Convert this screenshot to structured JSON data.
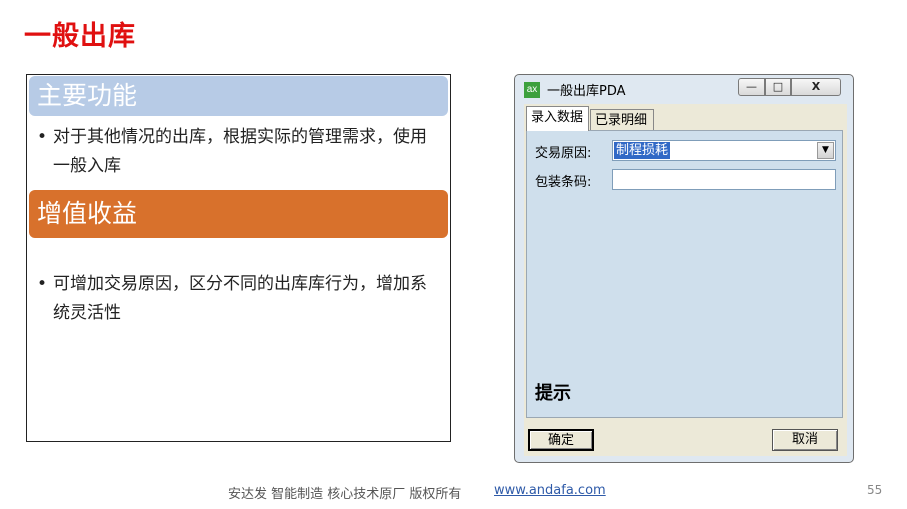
{
  "slide": {
    "title": "一般出库",
    "section1": {
      "header": "主要功能",
      "bullet": "对于其他情况的出库，根据实际的管理需求，使用一般入库"
    },
    "section2": {
      "header": "增值收益",
      "bullet": "可增加交易原因，区分不同的出库库行为，增加系统灵活性"
    }
  },
  "window": {
    "icon_text": "ax",
    "title": "一般出库PDA",
    "controls": {
      "minimize": "—",
      "maximize": "□",
      "close": "X"
    },
    "tabs": [
      {
        "label": "录入数据",
        "active": true
      },
      {
        "label": "已录明细",
        "active": false
      }
    ],
    "form": {
      "reason_label": "交易原因:",
      "reason_value": "制程损耗",
      "barcode_label": "包装条码:",
      "barcode_value": ""
    },
    "hint_label": "提示",
    "buttons": {
      "ok": "确定",
      "cancel": "取消"
    }
  },
  "footer": {
    "text": "安达发   智能制造 核心技术原厂    版权所有",
    "link": "www.andafa.com",
    "page_number": "55"
  },
  "colors": {
    "title_red": "#e01010",
    "header_blue": "#b7cbe6",
    "header_orange": "#d8712c",
    "selection_blue": "#3169c6"
  }
}
